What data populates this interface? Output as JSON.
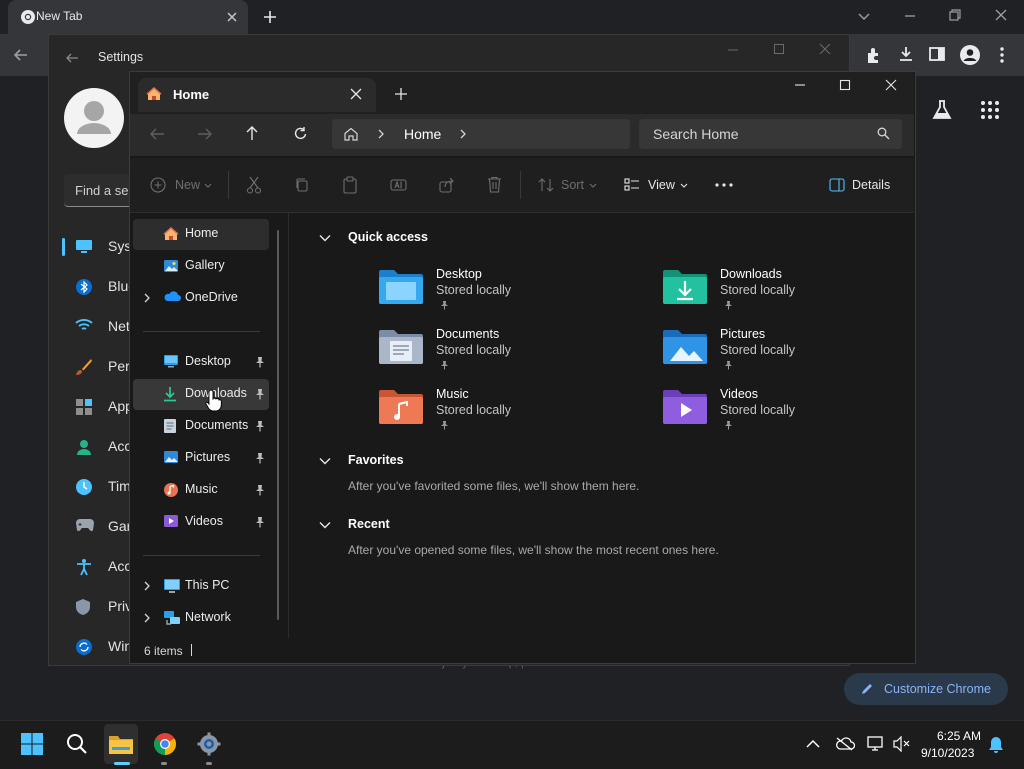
{
  "chrome": {
    "tab_title": "New Tab",
    "customize_label": "Customize Chrome",
    "faded_text": "adjust your Sleep, power mode"
  },
  "settings": {
    "title": "Settings",
    "find_placeholder": "Find a se",
    "items": [
      {
        "label": "Syst",
        "icon": "system-icon"
      },
      {
        "label": "Blue",
        "icon": "bluetooth-icon"
      },
      {
        "label": "Net",
        "icon": "wifi-icon"
      },
      {
        "label": "Pers",
        "icon": "brush-icon"
      },
      {
        "label": "App",
        "icon": "apps-icon"
      },
      {
        "label": "Acc",
        "icon": "accounts-icon"
      },
      {
        "label": "Tim",
        "icon": "time-icon"
      },
      {
        "label": "Gar",
        "icon": "gaming-icon"
      },
      {
        "label": "Acc",
        "icon": "accessibility-icon"
      },
      {
        "label": "Priv",
        "icon": "shield-icon"
      },
      {
        "label": "Win",
        "icon": "update-icon"
      }
    ]
  },
  "explorer": {
    "tab_title": "Home",
    "address": "Home",
    "search_placeholder": "Search Home",
    "commands": {
      "new": "New",
      "sort": "Sort",
      "view": "View",
      "details": "Details"
    },
    "nav": {
      "top": [
        {
          "label": "Home",
          "icon": "home-icon"
        },
        {
          "label": "Gallery",
          "icon": "gallery-icon"
        },
        {
          "label": "OneDrive",
          "icon": "onedrive-icon"
        }
      ],
      "pinned": [
        {
          "label": "Desktop",
          "icon": "desktop-folder-icon"
        },
        {
          "label": "Downloads",
          "icon": "downloads-icon"
        },
        {
          "label": "Documents",
          "icon": "documents-icon"
        },
        {
          "label": "Pictures",
          "icon": "pictures-icon"
        },
        {
          "label": "Music",
          "icon": "music-icon"
        },
        {
          "label": "Videos",
          "icon": "videos-icon"
        }
      ],
      "bottom": [
        {
          "label": "This PC",
          "icon": "pc-icon"
        },
        {
          "label": "Network",
          "icon": "network-icon"
        }
      ]
    },
    "quick_access": {
      "title": "Quick access",
      "items": [
        {
          "name": "Desktop",
          "sub": "Stored locally",
          "icon": "desktop-folder-icon"
        },
        {
          "name": "Downloads",
          "sub": "Stored locally",
          "icon": "downloads-folder-icon"
        },
        {
          "name": "Documents",
          "sub": "Stored locally",
          "icon": "documents-folder-icon"
        },
        {
          "name": "Pictures",
          "sub": "Stored locally",
          "icon": "pictures-folder-icon"
        },
        {
          "name": "Music",
          "sub": "Stored locally",
          "icon": "music-folder-icon"
        },
        {
          "name": "Videos",
          "sub": "Stored locally",
          "icon": "videos-folder-icon"
        }
      ]
    },
    "favorites": {
      "title": "Favorites",
      "message": "After you've favorited some files, we'll show them here."
    },
    "recent": {
      "title": "Recent",
      "message": "After you've opened some files, we'll show the most recent ones here."
    },
    "status": "6 items"
  },
  "taskbar": {
    "time": "6:25 AM",
    "date": "9/10/2023"
  },
  "colors": {
    "accent": "#4cc2ff",
    "folder": "#f2c14e",
    "chrome_link": "#8ab4f8"
  }
}
